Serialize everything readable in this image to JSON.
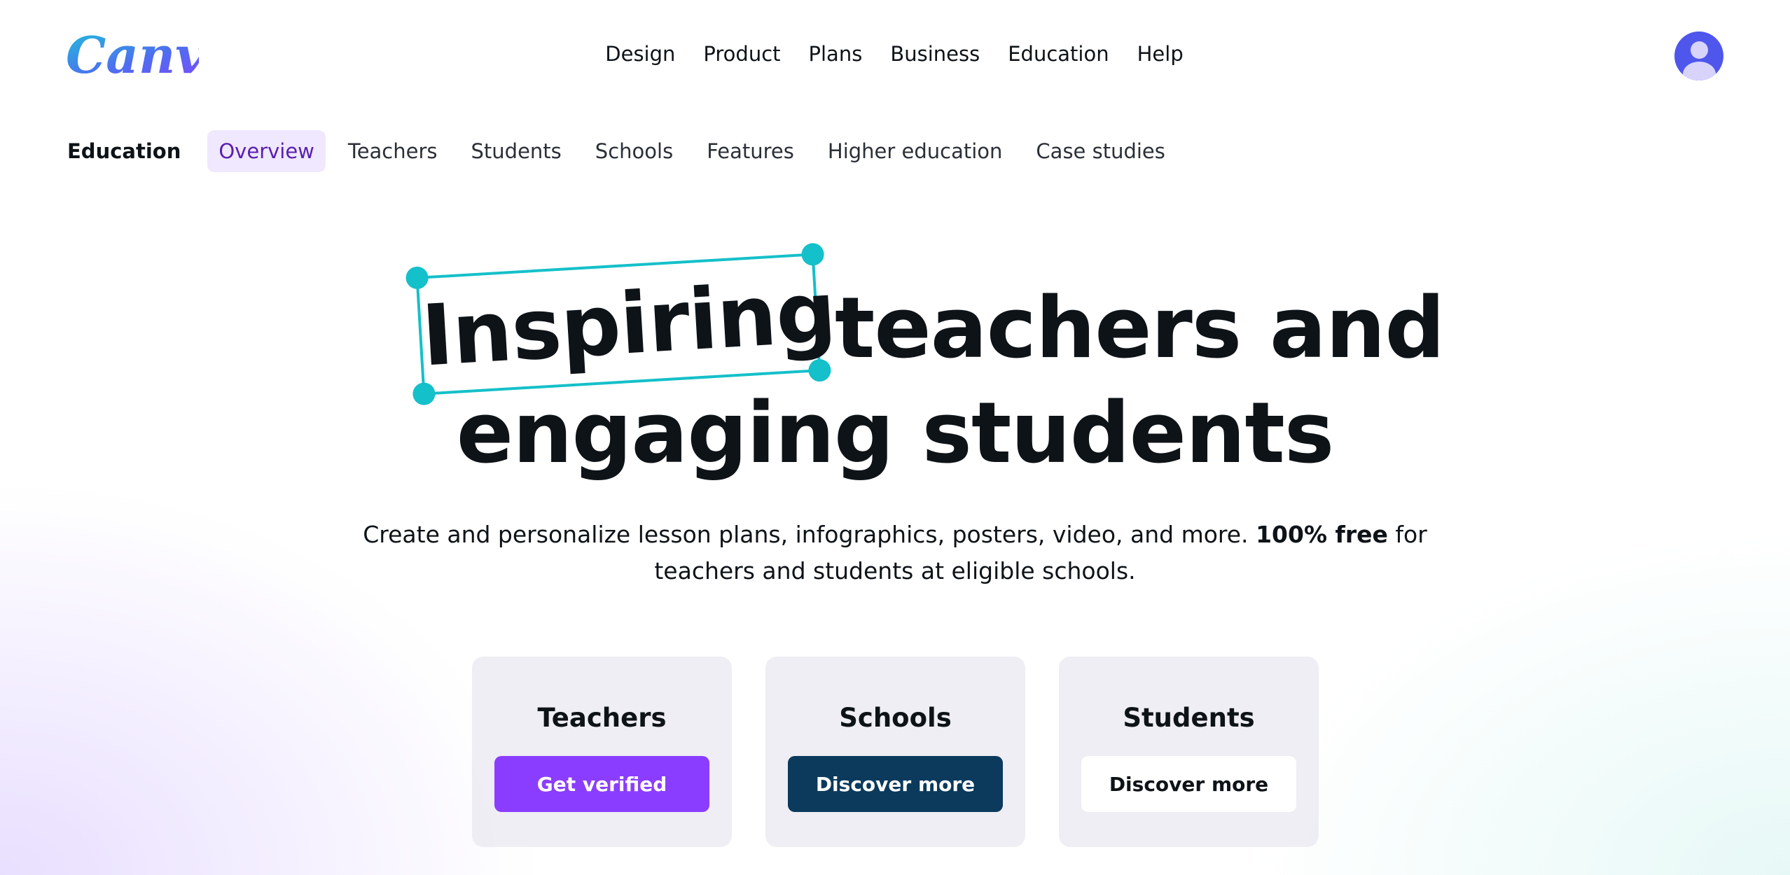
{
  "header": {
    "logo_text": "Canva",
    "nav": [
      "Design",
      "Product",
      "Plans",
      "Business",
      "Education",
      "Help"
    ],
    "avatar_icon": "user-avatar-icon"
  },
  "subnav": {
    "title": "Education",
    "items": [
      "Overview",
      "Teachers",
      "Students",
      "Schools",
      "Features",
      "Higher education",
      "Case studies"
    ],
    "active": "Overview"
  },
  "hero": {
    "highlight_word": "Inspiring",
    "line1_rest": "teachers and",
    "line2": "engaging students",
    "subtitle_part1": "Create and personalize lesson plans, infographics, posters, video, and more.",
    "subtitle_bold": "100% free",
    "subtitle_part2": "for",
    "subtitle_line2": "teachers and students at eligible schools."
  },
  "cards": [
    {
      "title": "Teachers",
      "button": "Get verified"
    },
    {
      "title": "Schools",
      "button": "Discover more"
    },
    {
      "title": "Students",
      "button": "Discover more"
    }
  ],
  "colors": {
    "accent_purple": "#8b3dff",
    "navy": "#0b3a5c",
    "teal_highlight": "#14c0c9",
    "active_tab_bg": "#efe8fe",
    "avatar_bg": "#4f56ec"
  }
}
